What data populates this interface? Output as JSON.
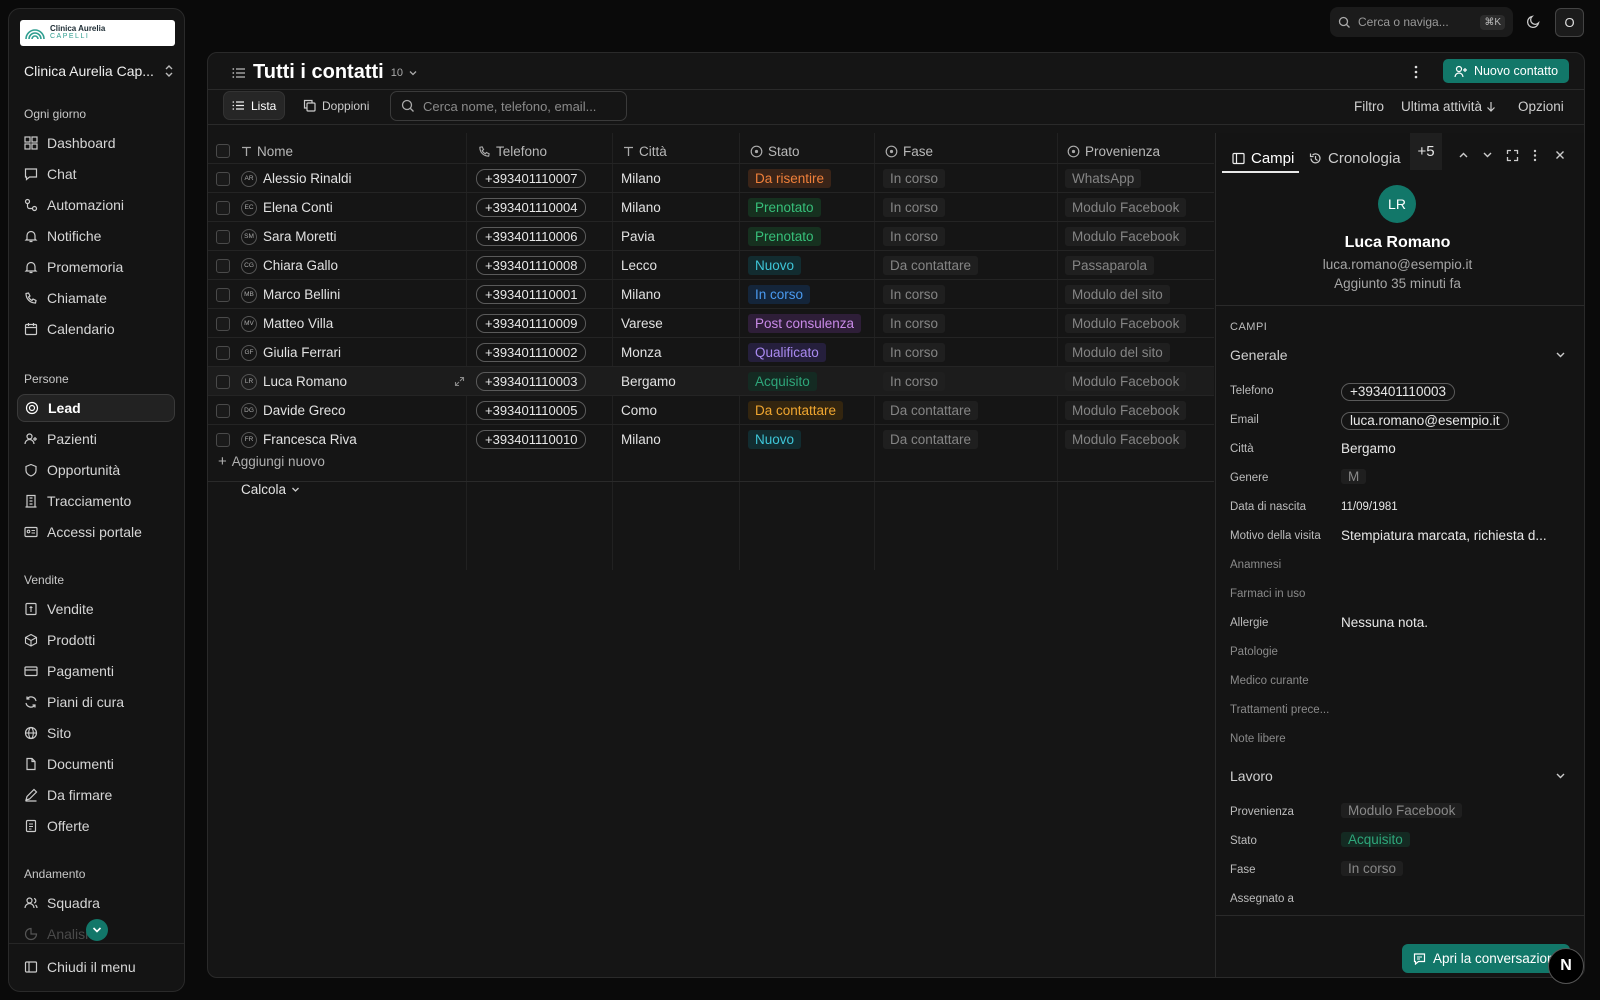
{
  "brand": {
    "name_line1": "Clinica Aurelia",
    "name_line2": "CAPELLI",
    "org": "Clinica Aurelia Cap..."
  },
  "sidebar": {
    "sections": [
      {
        "label": "Ogni giorno",
        "items": [
          "Dashboard",
          "Chat",
          "Automazioni",
          "Notifiche",
          "Promemoria",
          "Chiamate",
          "Calendario"
        ]
      },
      {
        "label": "Persone",
        "items": [
          "Lead",
          "Pazienti",
          "Opportunità",
          "Tracciamento",
          "Accessi portale"
        ]
      },
      {
        "label": "Vendite",
        "items": [
          "Vendite",
          "Prodotti",
          "Pagamenti",
          "Piani di cura",
          "Sito",
          "Documenti",
          "Da firmare",
          "Offerte"
        ]
      },
      {
        "label": "Andamento",
        "items": [
          "Squadra",
          "Analisi"
        ]
      }
    ],
    "close_menu": "Chiudi il menu"
  },
  "topbar": {
    "search_placeholder": "Cerca o naviga...",
    "shortcut": "⌘K",
    "user_initial": "O"
  },
  "view": {
    "title": "Tutti i contatti",
    "count": "10",
    "new_contact": "Nuovo contatto",
    "tab_list": "Lista",
    "tab_duplicates": "Doppioni",
    "search_placeholder": "Cerca nome, telefono, email...",
    "filter": "Filtro",
    "sort": "Ultima attività",
    "options": "Opzioni",
    "add_new": "Aggiungi nuovo",
    "calc": "Calcola"
  },
  "table": {
    "headers": {
      "name": "Nome",
      "phone": "Telefono",
      "city": "Città",
      "status": "Stato",
      "phase": "Fase",
      "source": "Provenienza"
    },
    "rows": [
      {
        "initials": "AR",
        "name": "Alessio Rinaldi",
        "phone": "+393401110007",
        "city": "Milano",
        "status": "Da risentire",
        "phase": "In corso",
        "source": "WhatsApp"
      },
      {
        "initials": "EC",
        "name": "Elena Conti",
        "phone": "+393401110004",
        "city": "Milano",
        "status": "Prenotato",
        "phase": "In corso",
        "source": "Modulo Facebook"
      },
      {
        "initials": "SM",
        "name": "Sara Moretti",
        "phone": "+393401110006",
        "city": "Pavia",
        "status": "Prenotato",
        "phase": "In corso",
        "source": "Modulo Facebook"
      },
      {
        "initials": "CG",
        "name": "Chiara Gallo",
        "phone": "+393401110008",
        "city": "Lecco",
        "status": "Nuovo",
        "phase": "Da contattare",
        "source": "Passaparola"
      },
      {
        "initials": "MB",
        "name": "Marco Bellini",
        "phone": "+393401110001",
        "city": "Milano",
        "status": "In corso",
        "phase": "In corso",
        "source": "Modulo del sito"
      },
      {
        "initials": "MV",
        "name": "Matteo Villa",
        "phone": "+393401110009",
        "city": "Varese",
        "status": "Post consulenza",
        "phase": "In corso",
        "source": "Modulo Facebook"
      },
      {
        "initials": "GF",
        "name": "Giulia Ferrari",
        "phone": "+393401110002",
        "city": "Monza",
        "status": "Qualificato",
        "phase": "In corso",
        "source": "Modulo del sito"
      },
      {
        "initials": "LR",
        "name": "Luca Romano",
        "phone": "+393401110003",
        "city": "Bergamo",
        "status": "Acquisito",
        "phase": "In corso",
        "source": "Modulo Facebook"
      },
      {
        "initials": "DG",
        "name": "Davide Greco",
        "phone": "+393401110005",
        "city": "Como",
        "status": "Da contattare",
        "phase": "Da contattare",
        "source": "Modulo Facebook"
      },
      {
        "initials": "FR",
        "name": "Francesca Riva",
        "phone": "+393401110010",
        "city": "Milano",
        "status": "Nuovo",
        "phase": "Da contattare",
        "source": "Modulo Facebook"
      }
    ]
  },
  "status_colors": {
    "Da risentire": {
      "fg": "#f0803a",
      "bg": "#3a2418"
    },
    "Prenotato": {
      "fg": "#37c07a",
      "bg": "#16301f"
    },
    "Nuovo": {
      "fg": "#3ec6d8",
      "bg": "#122c30"
    },
    "In corso": {
      "fg": "#4a9af0",
      "bg": "#14253a"
    },
    "Post consulenza": {
      "fg": "#c98ae8",
      "bg": "#2e1e38"
    },
    "Qualificato": {
      "fg": "#a98af0",
      "bg": "#251f3c"
    },
    "Acquisito": {
      "fg": "#2ea67a",
      "bg": "#142a22"
    },
    "Da contattare": {
      "fg": "#f0a630",
      "bg": "#33250f"
    }
  },
  "panel": {
    "tab_fields": "Campi",
    "tab_history": "Cronologia",
    "more_tabs": "+5",
    "initials": "LR",
    "name": "Luca Romano",
    "email": "luca.romano@esempio.it",
    "updated": "Aggiunto 35 minuti fa",
    "section_label": "CAMPI",
    "group_general": "Generale",
    "group_work": "Lavoro",
    "fields": {
      "phone_label": "Telefono",
      "phone": "+393401110003",
      "email_label": "Email",
      "email": "luca.romano@esempio.it",
      "city_label": "Città",
      "city": "Bergamo",
      "gender_label": "Genere",
      "gender": "M",
      "birth_label": "Data di nascita",
      "birth": "11/09/1981",
      "reason_label": "Motivo della visita",
      "reason": "Stempiatura marcata, richiesta d...",
      "anamnesi_label": "Anamnesi",
      "drugs_label": "Farmaci in uso",
      "allergies_label": "Allergie",
      "allergies": "Nessuna nota.",
      "patho_label": "Patologie",
      "doctor_label": "Medico curante",
      "prev_label": "Trattamenti prece...",
      "notes_label": "Note libere",
      "source_label": "Provenienza",
      "source": "Modulo Facebook",
      "status_label": "Stato",
      "status": "Acquisito",
      "phase_label": "Fase",
      "phase": "In corso",
      "assigned_label": "Assegnato a"
    },
    "open_chat": "Apri la conversazione"
  }
}
